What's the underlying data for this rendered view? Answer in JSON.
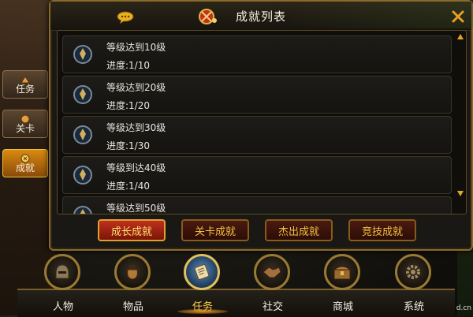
{
  "dialog": {
    "title": "成就列表",
    "achievements": [
      {
        "title": "等级达到10级",
        "progress": "进度:1/10"
      },
      {
        "title": "等级达到20级",
        "progress": "进度:1/20"
      },
      {
        "title": "等级达到30级",
        "progress": "进度:1/30"
      },
      {
        "title": "等级到达40级",
        "progress": "进度:1/40"
      },
      {
        "title": "等级达到50级",
        "progress": ""
      }
    ],
    "sub_tabs": [
      {
        "label": "成长成就",
        "active": true
      },
      {
        "label": "关卡成就",
        "active": false
      },
      {
        "label": "杰出成就",
        "active": false
      },
      {
        "label": "竞技成就",
        "active": false
      }
    ]
  },
  "side_tabs": [
    {
      "label": "任务",
      "icon": "quest-icon",
      "active": false
    },
    {
      "label": "关卡",
      "icon": "stage-icon",
      "active": false
    },
    {
      "label": "成就",
      "icon": "achievement-icon",
      "active": true
    }
  ],
  "bottom_nav": [
    {
      "label": "人物",
      "icon": "helmet-icon",
      "active": false
    },
    {
      "label": "物品",
      "icon": "bag-icon",
      "active": false
    },
    {
      "label": "任务",
      "icon": "scroll-icon",
      "active": true
    },
    {
      "label": "社交",
      "icon": "handshake-icon",
      "active": false
    },
    {
      "label": "商城",
      "icon": "chest-icon",
      "active": false
    },
    {
      "label": "系统",
      "icon": "gear-icon",
      "active": false
    }
  ],
  "watermark": "d.cn",
  "colors": {
    "gold": "#f2c13a",
    "active_red": "#c0301c",
    "active_orange": "#d88a10",
    "scroll_arrow": "#e5a623"
  }
}
